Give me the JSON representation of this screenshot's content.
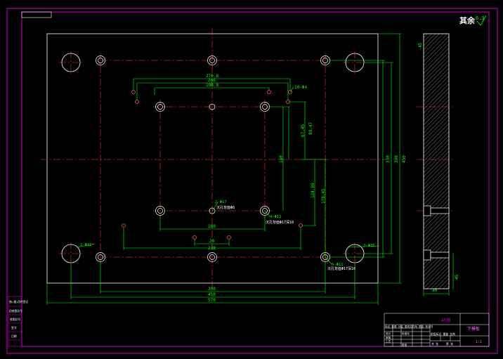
{
  "colors": {
    "background": "#000000",
    "frame": "#cc00cc",
    "outline": "#ffffff",
    "centerline": "#ff3030",
    "dimension": "#00ff00",
    "hatch": "#c8c8c8"
  },
  "title": {
    "surface_finish": "其余",
    "roughness": "6.3"
  },
  "dimensions": {
    "width_outer": "570",
    "width_mid": "450",
    "width_inner": "390",
    "top_1": "270.8",
    "top_2": "246",
    "top_3": "198.8",
    "bottom_1": "180",
    "bottom_2": "238",
    "bottom_3": "20",
    "hole_top_right": "10-Φ4",
    "vert_1": "67.45",
    "vert_2": "89.47",
    "vert_3": "180",
    "vert_4": "134.89",
    "vert_5": "178.45",
    "height_1": "330",
    "height_2": "390",
    "height_3": "450",
    "section_width": "40",
    "section_height": "45",
    "section_top": "45"
  },
  "callouts": {
    "left_bottom_hole": "2-Φ32",
    "right_bottom_hole": "2-Φ35",
    "center_hole": "2-Φ17",
    "center_hole_note": "沉孔背面Φ8",
    "mid_right_hole": "4-Φ11",
    "mid_right_note": "沉孔背面Φ17深10",
    "corner_hole": "6-Φ11",
    "corner_note": "沉孔背面Φ17深10"
  },
  "sidebar": {
    "labels": [
      "借(通)用件登记",
      "旧底图总号",
      "底图总号",
      "签字",
      "日期"
    ]
  },
  "title_block": {
    "material": "45钢",
    "part_name": "下模板",
    "scale": "1:1",
    "row_label": "标记 处数 分区 更改文件号 签名 年月日",
    "sub_labels": [
      "设计",
      "标准化",
      "审核",
      "工艺",
      "批准"
    ],
    "footer": [
      "共 张",
      "第 张"
    ],
    "weight_label": "阶段标记 重量 比例"
  }
}
